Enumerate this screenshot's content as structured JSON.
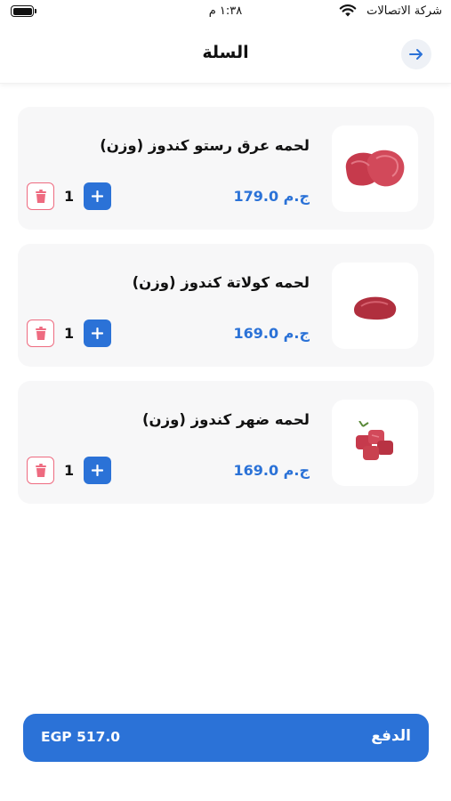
{
  "status_bar": {
    "carrier": "شركة الاتصالات",
    "time": "١:٣٨ م"
  },
  "header": {
    "title": "السلة"
  },
  "cart": {
    "items": [
      {
        "name": "لحمه عرق رستو كندوز (وزن)",
        "price": "ج.م 179.0",
        "quantity": "1"
      },
      {
        "name": "لحمه كولاتة كندوز (وزن)",
        "price": "ج.م 169.0",
        "quantity": "1"
      },
      {
        "name": "لحمه ضهر كندوز (وزن)",
        "price": "ج.م 169.0",
        "quantity": "1"
      }
    ]
  },
  "checkout": {
    "label": "الدفع",
    "total": "EGP 517.0"
  },
  "colors": {
    "accent": "#2b72d7",
    "delete": "#ee6b80",
    "card_bg": "#f7f7f8",
    "meat": "#c63a4c"
  }
}
